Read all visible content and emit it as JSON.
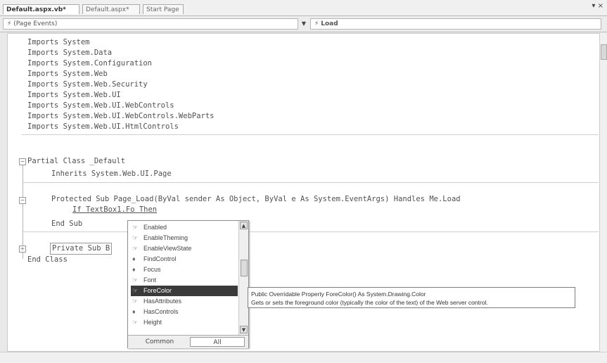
{
  "tabs": [
    {
      "label": "Default.aspx.vb*"
    },
    {
      "label": "Default.aspx*"
    },
    {
      "label": "Start Page"
    }
  ],
  "close_glyph": "▾ ×",
  "dropdowns": {
    "left": {
      "icon": "⚡",
      "value": "(Page Events)"
    },
    "right": {
      "icon": "⚡",
      "value": "Load"
    }
  },
  "code": {
    "imports": [
      "Imports System",
      "Imports System.Data",
      "Imports System.Configuration",
      "Imports System.Web",
      "Imports System.Web.Security",
      "Imports System.Web.UI",
      "Imports System.Web.UI.WebControls",
      "Imports System.Web.UI.WebControls.WebParts",
      "Imports System.Web.UI.HtmlControls"
    ],
    "class_decl": "Partial Class _Default",
    "inherits": "Inherits System.Web.UI.Page",
    "sub_decl": "Protected Sub Page_Load(ByVal sender As Object, ByVal e As System.EventArgs) Handles Me.Load",
    "if_line": "If TextBox1.Fo Then",
    "end_sub": "End Sub",
    "private_sub": "Private Sub B",
    "end_class": "End Class"
  },
  "intellisense": {
    "items": [
      {
        "icon": "☞",
        "label": "Enabled"
      },
      {
        "icon": "☞",
        "label": "EnableTheming"
      },
      {
        "icon": "☞",
        "label": "EnableViewState"
      },
      {
        "icon": "♦",
        "label": "FindControl"
      },
      {
        "icon": "♦",
        "label": "Focus"
      },
      {
        "icon": "☞",
        "label": "Font"
      },
      {
        "icon": "☞",
        "label": "ForeColor"
      },
      {
        "icon": "☞",
        "label": "HasAttributes"
      },
      {
        "icon": "♦",
        "label": "HasControls"
      },
      {
        "icon": "☞",
        "label": "Height"
      }
    ],
    "selected_index": 6,
    "tabs": [
      "Common",
      "All"
    ],
    "active_tab": "All"
  },
  "tooltip": {
    "signature": "Public Overridable Property ForeColor() As System.Drawing.Color",
    "description": "Gets or sets the foreground color (typically the color of the text) of the Web server control."
  },
  "colors": {
    "selection": "#3a3a3a"
  }
}
